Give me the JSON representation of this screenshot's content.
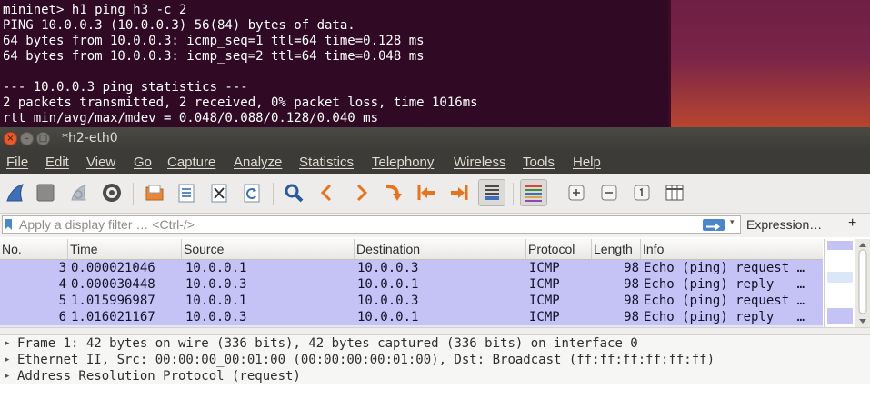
{
  "terminal": {
    "lines": [
      "mininet> h1 ping h3 -c 2",
      "PING 10.0.0.3 (10.0.0.3) 56(84) bytes of data.",
      "64 bytes from 10.0.0.3: icmp_seq=1 ttl=64 time=0.128 ms",
      "64 bytes from 10.0.0.3: icmp_seq=2 ttl=64 time=0.048 ms",
      "",
      "--- 10.0.0.3 ping statistics ---",
      "2 packets transmitted, 2 received, 0% packet loss, time 1016ms",
      "rtt min/avg/max/mdev = 0.048/0.088/0.128/0.040 ms"
    ]
  },
  "window": {
    "title": "*h2-eth0",
    "close_glyph": "×",
    "min_glyph": "–",
    "max_glyph": "□"
  },
  "menu": [
    "File",
    "Edit",
    "View",
    "Go",
    "Capture",
    "Analyze",
    "Statistics",
    "Telephony",
    "Wireless",
    "Tools",
    "Help"
  ],
  "toolbar": {
    "icons": [
      "shark-fin-start-icon",
      "stop-icon",
      "restart-capture-icon",
      "capture-options-icon",
      "open-file-icon",
      "save-file-icon",
      "close-file-icon",
      "reload-icon",
      "find-packet-icon",
      "go-back-icon",
      "go-forward-icon",
      "go-to-packet-icon",
      "first-packet-icon",
      "last-packet-icon",
      "autoscroll-icon",
      "colorize-icon",
      "zoom-in-icon",
      "zoom-out-icon",
      "normal-size-icon",
      "resize-columns-icon"
    ]
  },
  "filter": {
    "placeholder": "Apply a display filter … <Ctrl-/>",
    "expression_label": "Expression…",
    "add_label": "+",
    "dropdown_glyph": "▾"
  },
  "packet_list": {
    "columns": [
      "No.",
      "Time",
      "Source",
      "Destination",
      "Protocol",
      "Length",
      "Info"
    ],
    "rows": [
      {
        "no": "3",
        "time": "0.000021046",
        "source": "10.0.0.1",
        "destination": "10.0.0.3",
        "protocol": "ICMP",
        "length": "98",
        "info": "Echo (ping) request …"
      },
      {
        "no": "4",
        "time": "0.000030448",
        "source": "10.0.0.3",
        "destination": "10.0.0.1",
        "protocol": "ICMP",
        "length": "98",
        "info": "Echo (ping) reply   …"
      },
      {
        "no": "5",
        "time": "1.015996987",
        "source": "10.0.0.1",
        "destination": "10.0.0.3",
        "protocol": "ICMP",
        "length": "98",
        "info": "Echo (ping) request …"
      },
      {
        "no": "6",
        "time": "1.016021167",
        "source": "10.0.0.3",
        "destination": "10.0.0.1",
        "protocol": "ICMP",
        "length": "98",
        "info": "Echo (ping) reply   …"
      }
    ],
    "row_color": "#c5c2f5"
  },
  "details": {
    "arrow_glyph": "▶",
    "rows": [
      "Frame 1: 42 bytes on wire (336 bits), 42 bytes captured (336 bits) on interface 0",
      "Ethernet II, Src: 00:00:00_00:01:00 (00:00:00:00:01:00), Dst: Broadcast (ff:ff:ff:ff:ff:ff)",
      "Address Resolution Protocol (request)"
    ]
  },
  "colors": {
    "terminal_bg": "#300a24",
    "titlebar_bg": "#3c3b37",
    "accent_blue": "#4a86c8",
    "close_button": "#e85a2c"
  }
}
